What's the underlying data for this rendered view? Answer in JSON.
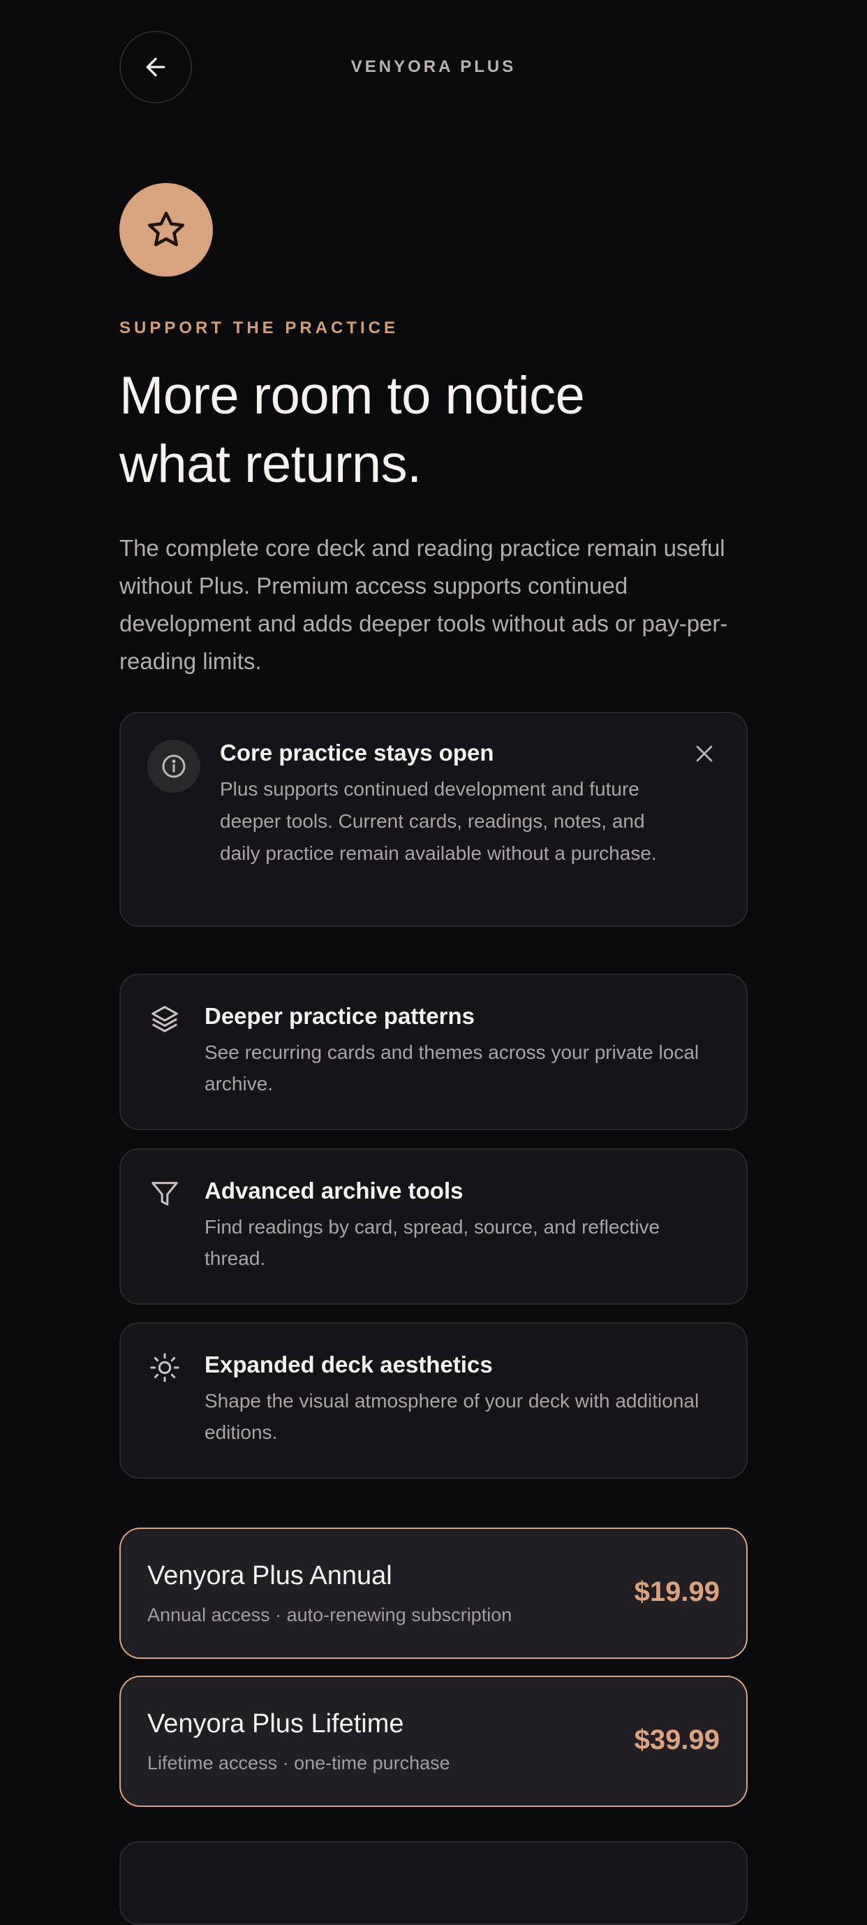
{
  "header": {
    "title": "VENYORA PLUS",
    "back_icon": "arrow-left-icon"
  },
  "hero": {
    "badge_icon": "star-icon",
    "eyebrow": "SUPPORT THE PRACTICE",
    "headline_line1": "More room to notice",
    "headline_line2": "what returns.",
    "lede": "The complete core deck and reading practice remain useful without Plus. Premium access supports continued development and adds deeper tools without ads or pay-per-reading limits."
  },
  "notice": {
    "icon": "info-icon",
    "title": "Core practice stays open",
    "body": "Plus supports continued development and future deeper tools. Current cards, readings, notes, and daily practice remain available without a purchase.",
    "close_icon": "close-icon"
  },
  "features": [
    {
      "icon": "layers-icon",
      "title": "Deeper practice patterns",
      "body": "See recurring cards and themes across your private local archive."
    },
    {
      "icon": "filter-icon",
      "title": "Advanced archive tools",
      "body": "Find readings by card, spread, source, and reflective thread."
    },
    {
      "icon": "sun-icon",
      "title": "Expanded deck aesthetics",
      "body": "Shape the visual atmosphere of your deck with additional editions."
    }
  ],
  "plans": [
    {
      "name": "Venyora Plus Annual",
      "subtitle": "Annual access · auto-renewing subscription",
      "price": "$19.99"
    },
    {
      "name": "Venyora Plus Lifetime",
      "subtitle": "Lifetime access · one-time purchase",
      "price": "$39.99"
    }
  ],
  "colors": {
    "background": "#0b0a0c",
    "accent": "#d9a37e",
    "card": "#161418",
    "plan_card": "#221f24"
  }
}
